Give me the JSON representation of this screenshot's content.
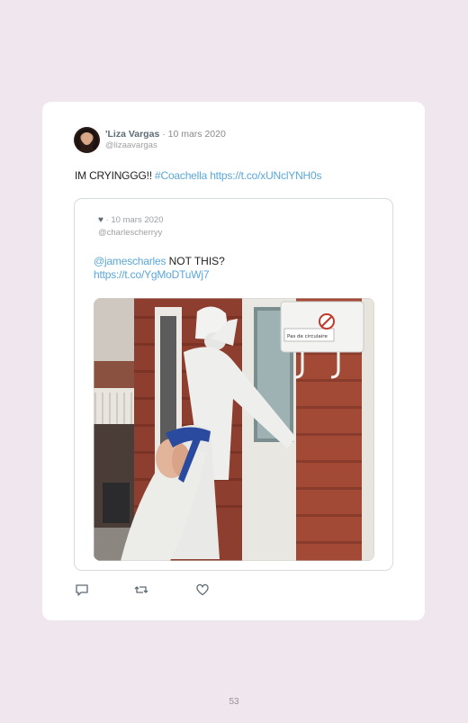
{
  "tweet": {
    "author_name": "'Liza Vargas",
    "separator": "·",
    "date": "10 mars 2020",
    "handle": "@lizaavargas",
    "text": "IM CRYINGGG!! ",
    "hashtag": "#Coachella",
    "link": "https://t.co/xUNclYNH0s",
    "avatar_icon": "profile-photo"
  },
  "quoted_tweet": {
    "icon": "heart",
    "heart_glyph": "♥",
    "date": "· 10 mars 2020",
    "handle": "@charlescherryy",
    "mention": "@jamescharles",
    "text": " NOT THIS?",
    "link": "https://t.co/YgMoDTuWj7",
    "photo_sign_text": "Pas de circulaire"
  },
  "actions": [
    {
      "name": "reply",
      "icon": "speech-bubble-icon"
    },
    {
      "name": "retweet",
      "icon": "retweet-icon"
    },
    {
      "name": "like",
      "icon": "heart-outline-icon"
    }
  ],
  "colors": {
    "link": "#5aa7d8",
    "page_bg": "#efe6ee",
    "card_bg": "#ffffff"
  },
  "page_number": "53"
}
